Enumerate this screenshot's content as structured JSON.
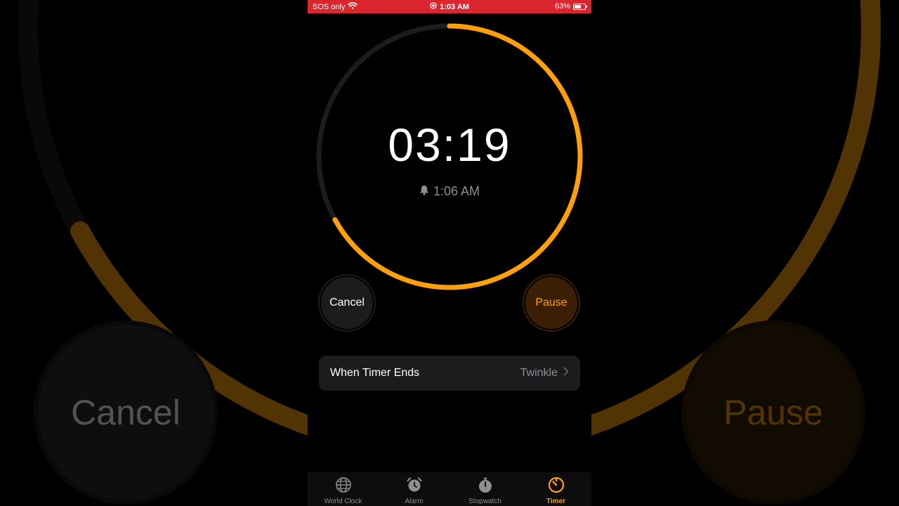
{
  "status_bar": {
    "carrier": "SOS only",
    "time": "1:03 AM",
    "battery": "63%",
    "battery_level": 0.63,
    "bar_color": "#d9262f"
  },
  "timer": {
    "remaining": "03:19",
    "ends_at": "1:06 AM",
    "progress_remaining": 0.67,
    "accent_color": "#ff9f0a",
    "track_color": "#1c1c1e"
  },
  "controls": {
    "cancel_label": "Cancel",
    "pause_label": "Pause"
  },
  "settings": {
    "when_timer_ends_label": "When Timer Ends",
    "when_timer_ends_value": "Twinkle"
  },
  "tabs": [
    {
      "label": "World Clock",
      "icon": "globe-icon",
      "active": false
    },
    {
      "label": "Alarm",
      "icon": "alarm-clock-icon",
      "active": false
    },
    {
      "label": "Stopwatch",
      "icon": "stopwatch-icon",
      "active": false
    },
    {
      "label": "Timer",
      "icon": "timer-icon",
      "active": true
    }
  ]
}
